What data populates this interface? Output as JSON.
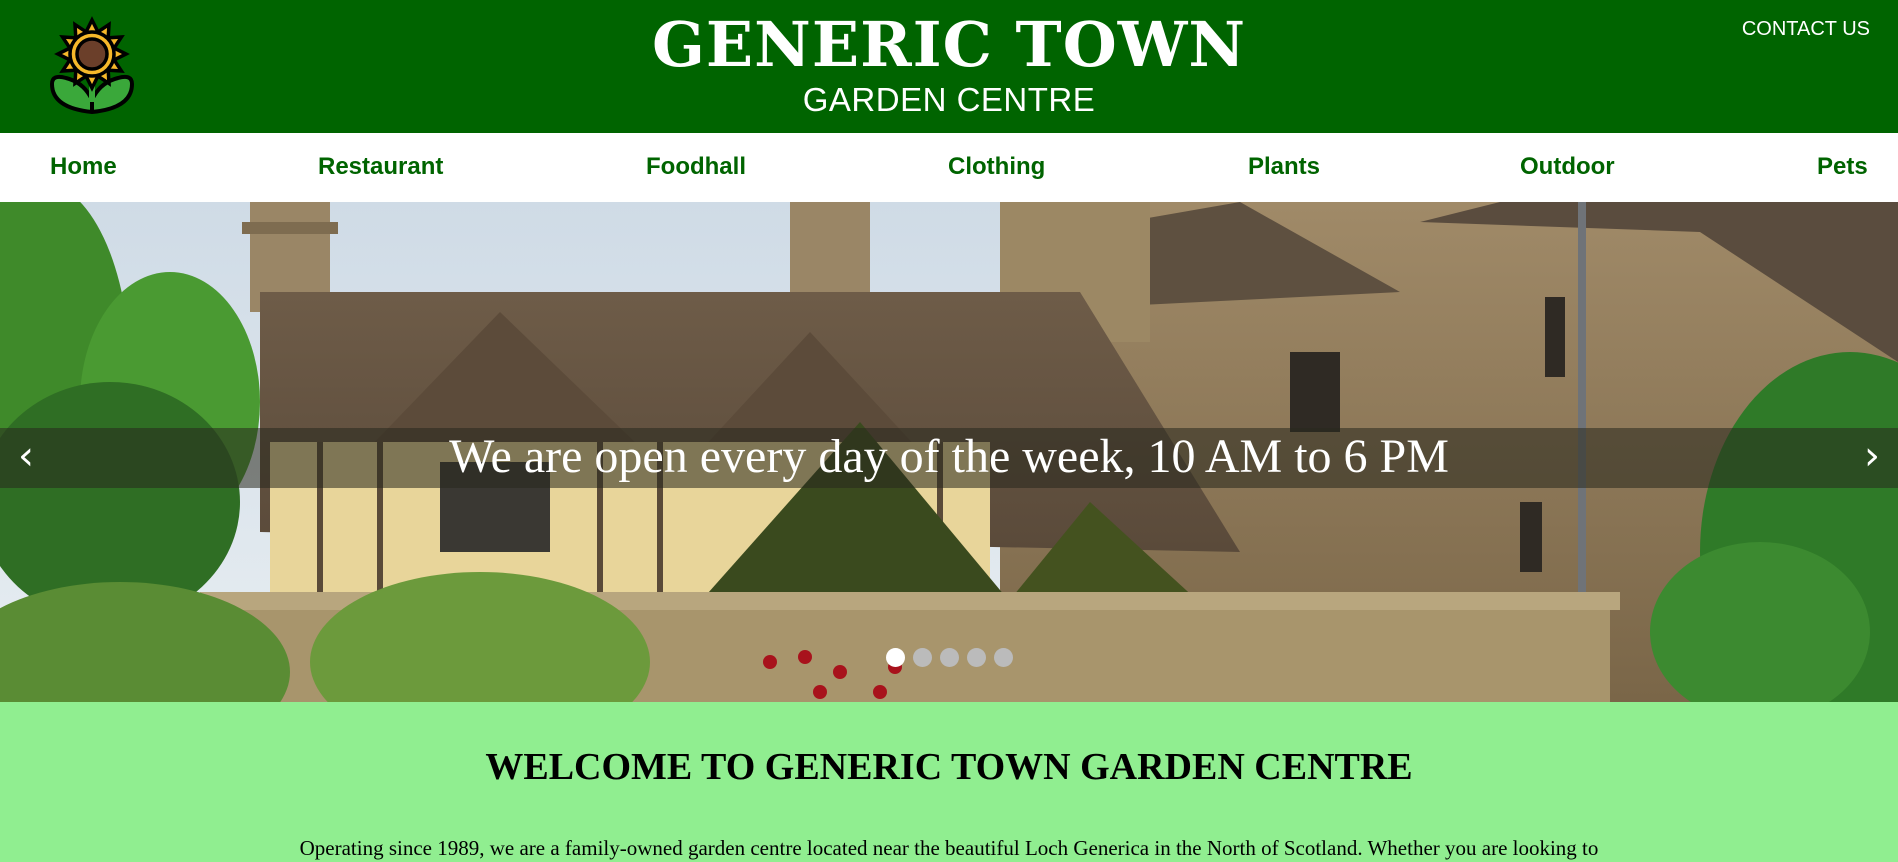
{
  "header": {
    "title": "GENERIC TOWN",
    "subtitle": "GARDEN CENTRE",
    "contact_label": "CONTACT US",
    "logo_icon": "sunflower-icon",
    "background_color": "#006400"
  },
  "nav": {
    "items": [
      {
        "label": "Home"
      },
      {
        "label": "Restaurant"
      },
      {
        "label": "Foodhall"
      },
      {
        "label": "Clothing"
      },
      {
        "label": "Plants"
      },
      {
        "label": "Outdoor"
      },
      {
        "label": "Pets"
      }
    ],
    "text_color": "#006400"
  },
  "slideshow": {
    "caption": "We are open every day of the week, 10 AM to 6 PM",
    "prev_label": "‹",
    "next_label": "›",
    "slide_count": 5,
    "active_slide": 1
  },
  "main": {
    "heading": "WELCOME TO GENERIC TOWN GARDEN CENTRE",
    "intro": "Operating since 1989, we are a family-owned garden centre located near the beautiful Loch Generica in the North of Scotland. Whether you are looking to",
    "background_color": "#90ee90"
  }
}
